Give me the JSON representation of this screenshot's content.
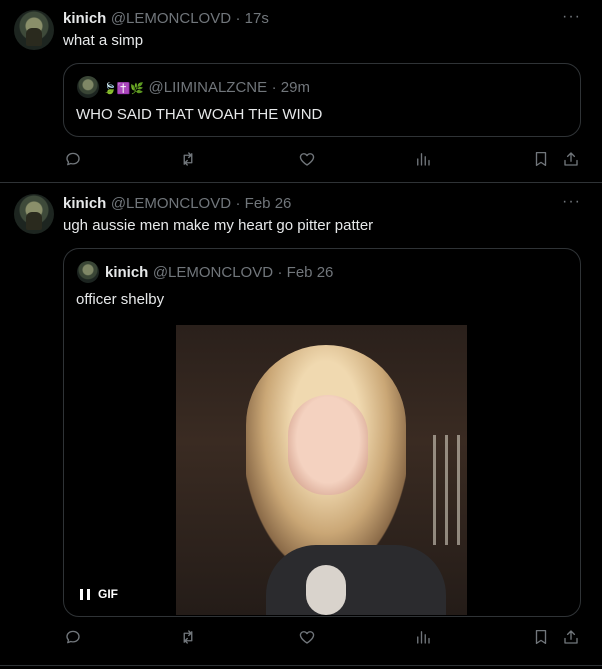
{
  "tweets": [
    {
      "name": "kinich",
      "handle": "@LEMONCLOVD",
      "time": "· 17s",
      "text": "what a simp",
      "more": "···",
      "quote": {
        "deco": "🍃✝️🌿",
        "handle": "@LIIMINALZCNE",
        "time": "· 29m",
        "text": "WHO SAID THAT WOAH THE WIND"
      }
    },
    {
      "name": "kinich",
      "handle": "@LEMONCLOVD",
      "time": "· Feb 26",
      "text": "ugh aussie men make my heart go pitter patter",
      "more": "···",
      "quote": {
        "name": "kinich",
        "handle": "@LEMONCLOVD",
        "time": "· Feb 26",
        "text": "officer shelby",
        "gif_label": "GIF"
      }
    }
  ],
  "actions": [
    "reply-icon",
    "retweet-icon",
    "like-icon",
    "views-icon",
    "bookmark-icon",
    "share-icon"
  ],
  "colors": {
    "background": "#000000",
    "text": "#e7e9ea",
    "muted": "#71767b",
    "border": "#2f3336"
  }
}
